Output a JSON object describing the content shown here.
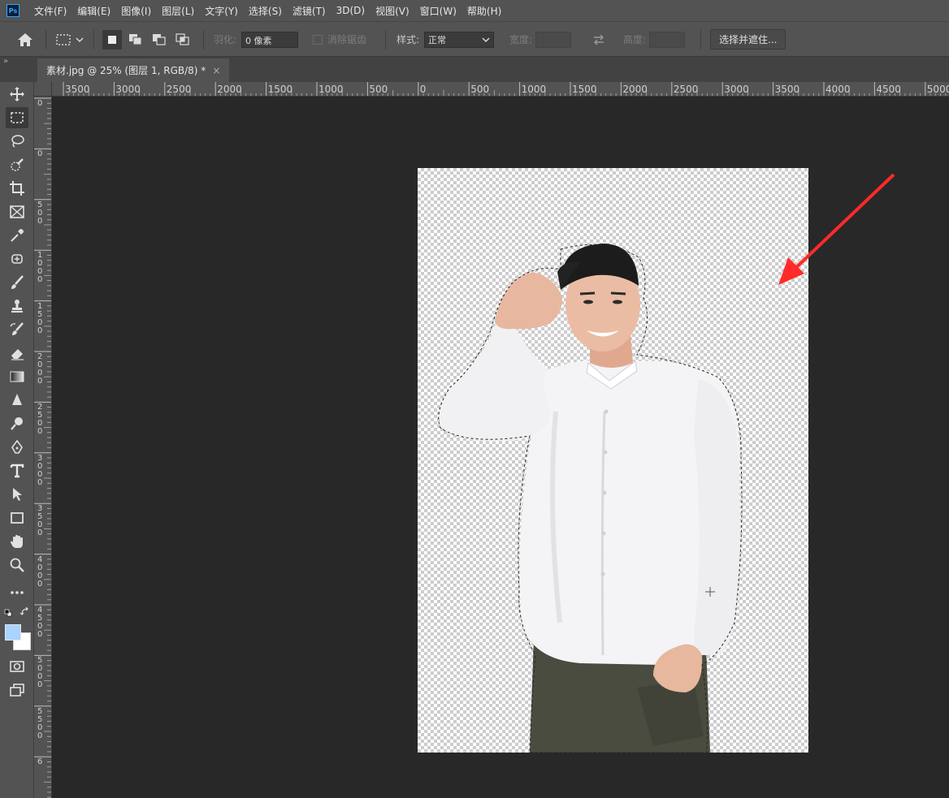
{
  "menu": {
    "logo": "Ps",
    "items": [
      "文件(F)",
      "编辑(E)",
      "图像(I)",
      "图层(L)",
      "文字(Y)",
      "选择(S)",
      "滤镜(T)",
      "3D(D)",
      "视图(V)",
      "窗口(W)",
      "帮助(H)"
    ]
  },
  "options": {
    "feather_label": "羽化:",
    "feather_value": "0 像素",
    "antialias_label": "消除锯齿",
    "style_label": "样式:",
    "style_value": "正常",
    "width_label": "宽度:",
    "height_label": "高度:",
    "select_mask_button": "选择并遮住..."
  },
  "tab": {
    "title": "素材.jpg @ 25% (图层 1, RGB/8) *",
    "close": "×"
  },
  "ruler_top_labels": [
    "3500",
    "3000",
    "2500",
    "2000",
    "1500",
    "1000",
    "500",
    "0",
    "500",
    "1000",
    "1500",
    "2000",
    "2500",
    "3000",
    "3500",
    "4000",
    "4500",
    "5000"
  ],
  "ruler_left_labels": [
    "0",
    "0",
    "500",
    "1000",
    "1500",
    "2000",
    "2500",
    "3000",
    "3500",
    "4000",
    "4500",
    "5000",
    "5500",
    "6"
  ],
  "colors": {
    "foreground": "#a8d4ff",
    "background": "#ffffff",
    "arrow": "#ff2a2a",
    "ps_blue": "#31a8ff"
  },
  "tools": [
    "move-tool",
    "marquee-tool",
    "lasso-tool",
    "quick-select-tool",
    "crop-tool",
    "frame-tool",
    "eyedropper-tool",
    "healing-tool",
    "brush-tool",
    "stamp-tool",
    "history-brush-tool",
    "eraser-tool",
    "gradient-tool",
    "blur-tool",
    "dodge-tool",
    "pen-tool",
    "type-tool",
    "path-select-tool",
    "rectangle-tool",
    "hand-tool",
    "zoom-tool",
    "more-tools"
  ]
}
